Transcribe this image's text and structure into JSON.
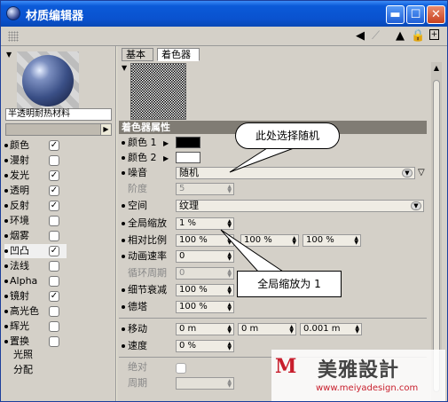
{
  "window": {
    "title": "材质编辑器"
  },
  "title_buttons": {
    "minimize": "▬",
    "maximize": "☐",
    "close": "✕"
  },
  "toolbar": {
    "back_icon": "◀",
    "forward_icon": "▶",
    "up_icon": "▲",
    "lock_icon": "lock",
    "add_icon": "+"
  },
  "material": {
    "name": "半透明耐热材料"
  },
  "channels": [
    {
      "label": "颜色",
      "checked": true
    },
    {
      "label": "漫射",
      "checked": false
    },
    {
      "label": "发光",
      "checked": true
    },
    {
      "label": "透明",
      "checked": true
    },
    {
      "label": "反射",
      "checked": true
    },
    {
      "label": "环境",
      "checked": false
    },
    {
      "label": "烟雾",
      "checked": false
    },
    {
      "label": "凹凸",
      "checked": true
    },
    {
      "label": "法线",
      "checked": false
    },
    {
      "label": "Alpha",
      "checked": false
    },
    {
      "label": "镜射",
      "checked": true
    },
    {
      "label": "高光色",
      "checked": false
    },
    {
      "label": "辉光",
      "checked": false
    },
    {
      "label": "置换",
      "checked": false
    }
  ],
  "extra_items": [
    "光照",
    "分配"
  ],
  "tabs": [
    "基本",
    "着色器"
  ],
  "section_title": "着色器属性",
  "props": {
    "color1": "颜色 1",
    "color2": "颜色 2",
    "noise_label": "噪音",
    "noise_value": "随机",
    "octave_label": "阶度",
    "octave_value": "5",
    "space_label": "空间",
    "space_value": "纹理",
    "global_scale_label": "全局缩放",
    "global_scale_value": "1 %",
    "relative_scale_label": "相对比例",
    "relative_scale_values": [
      "100 %",
      "100 %",
      "100 %"
    ],
    "anim_speed_label": "动画速率",
    "anim_speed_value": "0",
    "loop_period_label": "循环周期",
    "loop_period_value": "0",
    "detail_atten_label": "细节衰减",
    "detail_atten_value": "100 %",
    "delta_label": "德塔",
    "delta_value": "100 %",
    "move_label": "移动",
    "move_values": [
      "0 m",
      "0 m",
      "0.001 m"
    ],
    "speed_label": "速度",
    "speed_value": "0 %",
    "absolute_label": "绝对",
    "period_label": "周期"
  },
  "callouts": {
    "random": "此处选择随机",
    "scale": "全局缩放为 1"
  },
  "watermark": {
    "logo_text": "美雅設計",
    "url": "www.meiyadesign.com"
  },
  "colors": {
    "title_bar": "#0a52cf",
    "panel": "#d4d0c8",
    "section": "#807c74",
    "watermark_red": "#c81e2c"
  }
}
